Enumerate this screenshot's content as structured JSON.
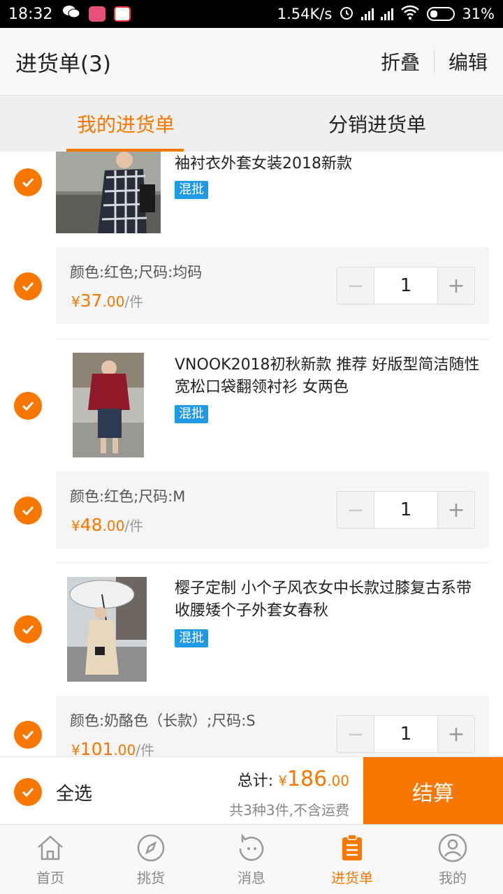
{
  "status_bar": {
    "time": "18:32",
    "speed": "1.54K/s",
    "battery": "31%"
  },
  "header": {
    "title": "进货单(3)",
    "fold_label": "折叠",
    "edit_label": "编辑"
  },
  "tabs": [
    {
      "label": "我的进货单",
      "active": true
    },
    {
      "label": "分销进货单",
      "active": false
    }
  ],
  "items": [
    {
      "name": "袖衬衣外套女装2018新款",
      "tag": "混批",
      "sku": "颜色:红色;尺码:均码",
      "currency": "¥",
      "price_int": "37",
      "price_dec": ".00",
      "unit": "/件",
      "quantity": "1"
    },
    {
      "name": "VNOOK2018初秋新款 推荐 好版型简洁随性宽松口袋翻领衬衫 女两色",
      "tag": "混批",
      "sku": "颜色:红色;尺码:M",
      "currency": "¥",
      "price_int": "48",
      "price_dec": ".00",
      "unit": "/件",
      "quantity": "1"
    },
    {
      "name": "樱子定制 小个子风衣女中长款过膝复古系带收腰矮个子外套女春秋",
      "tag": "混批",
      "sku": "颜色:奶酪色（长款）;尺码:S",
      "currency": "¥",
      "price_int": "101",
      "price_dec": ".00",
      "unit": "/件",
      "quantity": "1"
    }
  ],
  "checkout": {
    "select_all_label": "全选",
    "total_label": "总计:",
    "currency": "¥",
    "total_int": "186",
    "total_dec": ".00",
    "note": "共3种3件,不含运费",
    "pay_label": "结算"
  },
  "nav": [
    {
      "label": "首页",
      "icon": "home-icon"
    },
    {
      "label": "挑货",
      "icon": "compass-icon"
    },
    {
      "label": "消息",
      "icon": "message-icon"
    },
    {
      "label": "进货单",
      "icon": "clipboard-icon",
      "active": true
    },
    {
      "label": "我的",
      "icon": "user-icon"
    }
  ],
  "colors": {
    "accent": "#f77700",
    "tag_blue": "#1e9ae6"
  }
}
